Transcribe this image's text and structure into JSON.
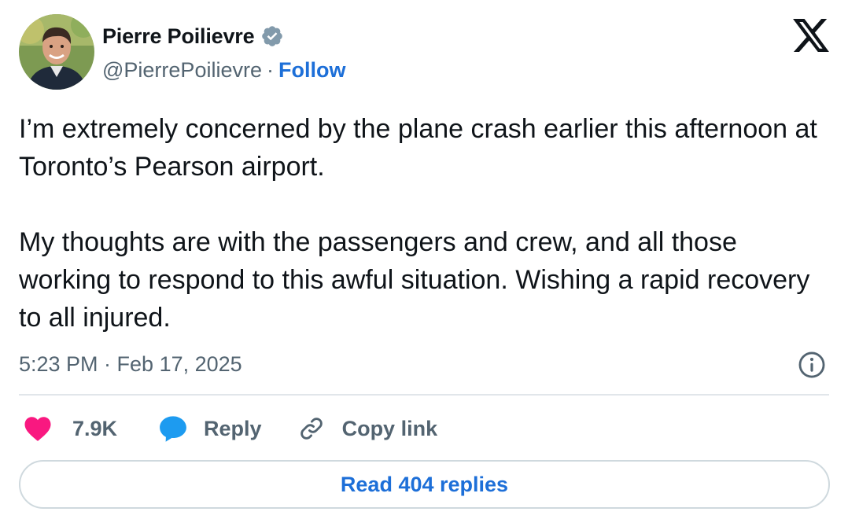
{
  "author": {
    "name": "Pierre Poilievre",
    "handle": "@PierrePoilievre",
    "separator": "·",
    "follow_label": "Follow",
    "verified_icon": "verified-badge-icon",
    "avatar_icon": "profile-photo"
  },
  "brand": {
    "logo_icon": "x-logo-icon"
  },
  "tweet": {
    "paragraphs": [
      "I’m extremely concerned by the plane crash earlier this afternoon at Toronto’s Pearson airport.",
      "My thoughts are with the passengers and crew, and all those working to respond to this awful situation. Wishing a rapid recovery to all injured."
    ],
    "timestamp": "5:23 PM · Feb 17, 2025",
    "info_icon": "info-icon"
  },
  "actions": {
    "like_count": "7.9K",
    "like_icon": "heart-icon",
    "reply_label": "Reply",
    "reply_icon": "speech-bubble-icon",
    "copy_label": "Copy link",
    "copy_icon": "link-icon"
  },
  "read_replies_label": "Read 404 replies",
  "colors": {
    "text": "#0f1419",
    "secondary": "#536471",
    "link_blue": "#1d6fd8",
    "like_pink": "#f91880",
    "reply_blue": "#1d9bf0",
    "verified_gray": "#829aab",
    "divider": "#e1e6ea"
  }
}
